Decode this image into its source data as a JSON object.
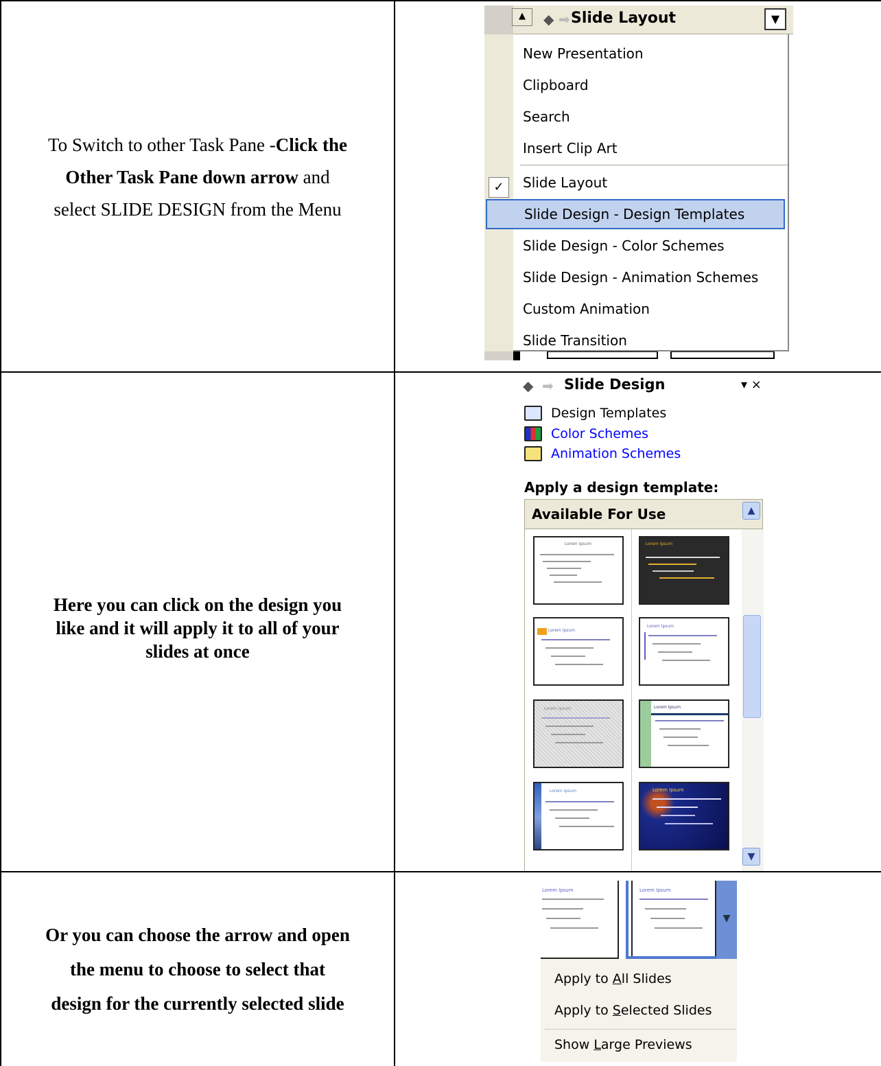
{
  "row1": {
    "instruction_pre": "To Switch to other Task Pane -",
    "instruction_bold_1": "Click the",
    "instruction_bold_2": "Other Task Pane down arrow",
    "instruction_post_1": "and",
    "instruction_post_2": "select SLIDE DESIGN from the Menu",
    "pane_title": "Slide Layout",
    "menu_items": [
      "New Presentation",
      "Clipboard",
      "Search",
      "Insert Clip Art",
      "Slide Layout",
      "Slide Design - Design Templates",
      "Slide Design - Color Schemes",
      "Slide Design - Animation Schemes",
      "Custom Animation",
      "Slide Transition"
    ],
    "checked_item": "Slide Layout",
    "highlighted_item": "Slide Design - Design Templates"
  },
  "row2": {
    "instruction_line_1": "Here you can click on the design you",
    "instruction_line_2": "like and it will apply it to all of your",
    "instruction_line_3": "slides at once",
    "pane_title": "Slide Design",
    "links": [
      "Design Templates",
      "Color Schemes",
      "Animation Schemes"
    ],
    "apply_heading": "Apply a design template:",
    "section_header": "Available For Use",
    "thumbnail_title": "Lorem Ipsum"
  },
  "row3": {
    "instruction_line_1": "Or you can choose the arrow and open",
    "instruction_line_2": "the menu to choose to select that",
    "instruction_line_3": "design for the currently selected slide",
    "menu_items": [
      {
        "pre": "Apply to ",
        "accel": "A",
        "post": "ll Slides"
      },
      {
        "pre": "Apply to ",
        "accel": "S",
        "post": "elected Slides"
      },
      {
        "pre": "Show ",
        "accel": "L",
        "post": "arge Previews"
      }
    ]
  },
  "colors": {
    "highlight_fill": "#c1d2ee",
    "highlight_border": "#316ac5",
    "link_blue": "#0000ff",
    "pane_header": "#ece9d8"
  }
}
